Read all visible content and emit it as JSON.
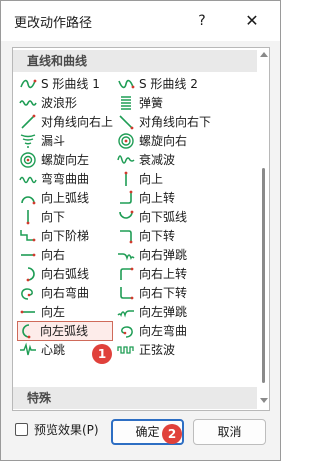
{
  "dialog": {
    "title": "更改动作路径",
    "help_label": "?",
    "close_label": "✕"
  },
  "list": {
    "section1": "直线和曲线",
    "section2": "特殊",
    "items": [
      {
        "label": "S 形曲线 1",
        "icon": "s-curve-1-icon"
      },
      {
        "label": "S 形曲线 2",
        "icon": "s-curve-2-icon"
      },
      {
        "label": "波浪形",
        "icon": "wave-icon"
      },
      {
        "label": "弹簧",
        "icon": "spring-icon"
      },
      {
        "label": "对角线向右上",
        "icon": "diagonal-up-right-icon"
      },
      {
        "label": "对角线向右下",
        "icon": "diagonal-down-right-icon"
      },
      {
        "label": "漏斗",
        "icon": "funnel-icon"
      },
      {
        "label": "螺旋向右",
        "icon": "spiral-right-icon"
      },
      {
        "label": "螺旋向左",
        "icon": "spiral-left-icon"
      },
      {
        "label": "衰减波",
        "icon": "decaying-wave-icon"
      },
      {
        "label": "弯弯曲曲",
        "icon": "zigzag-icon"
      },
      {
        "label": "向上",
        "icon": "up-icon"
      },
      {
        "label": "向上弧线",
        "icon": "arc-up-icon"
      },
      {
        "label": "向上转",
        "icon": "turn-up-icon"
      },
      {
        "label": "向下",
        "icon": "down-icon"
      },
      {
        "label": "向下弧线",
        "icon": "arc-down-icon"
      },
      {
        "label": "向下阶梯",
        "icon": "stairs-down-icon"
      },
      {
        "label": "向下转",
        "icon": "turn-down-icon"
      },
      {
        "label": "向右",
        "icon": "right-icon"
      },
      {
        "label": "向右弹跳",
        "icon": "bounce-right-icon"
      },
      {
        "label": "向右弧线",
        "icon": "arc-right-icon"
      },
      {
        "label": "向右上转",
        "icon": "turn-up-right-icon"
      },
      {
        "label": "向右弯曲",
        "icon": "curvy-right-icon"
      },
      {
        "label": "向右下转",
        "icon": "turn-down-right-icon"
      },
      {
        "label": "向左",
        "icon": "left-icon"
      },
      {
        "label": "向左弹跳",
        "icon": "bounce-left-icon"
      },
      {
        "label": "向左弧线",
        "icon": "arc-left-icon"
      },
      {
        "label": "向左弯曲",
        "icon": "curvy-left-icon"
      },
      {
        "label": "心跳",
        "icon": "heartbeat-icon"
      },
      {
        "label": "正弦波",
        "icon": "sine-wave-icon"
      }
    ]
  },
  "annotations": {
    "badge1": "1",
    "badge2": "2"
  },
  "footer": {
    "preview_label": "预览效果(P)",
    "ok_label": "确定",
    "cancel_label": "取消"
  },
  "colors": {
    "path_green": "#1f9d55",
    "path_end_red": "#d23a2e",
    "selection_border": "#cf6a5a",
    "ok_border": "#2d6ec3",
    "badge": "#e0413b"
  }
}
